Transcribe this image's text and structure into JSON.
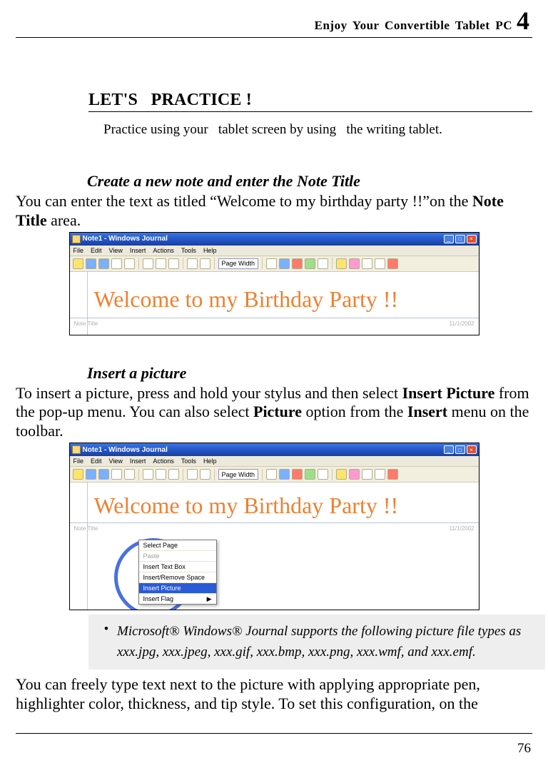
{
  "header": {
    "running_title": "Enjoy  Your  Convertible  Tablet  PC",
    "chapter_number": "4"
  },
  "section_heading_1": "L",
  "section_heading_rest": "ET'S   P",
  "section_heading_rest2": "RACTICE !",
  "intro_line": "Practice using your   tablet screen by using   the writing tablet.",
  "subhead1": "Create a new note and enter the Note Title",
  "para1_a": "You can enter the text as titled “Welcome to my birthday party !!”on the ",
  "para1_b": "Note Title",
  "para1_c": " area.",
  "subhead2": "Insert a picture",
  "para2_a": "To insert a picture, press and hold your stylus and then select ",
  "para2_b": "Insert Picture",
  "para2_c": " from the pop-up menu. You can also select ",
  "para2_d": "Picture",
  "para2_e": " option from the ",
  "para2_f": "Insert",
  "para2_g": " menu on the toolbar.",
  "note_bullet": "•",
  "note_text": "Microsoft® Windows® Journal supports the following picture file types as xxx.jpg, xxx.jpeg, xxx.gif, xxx.bmp, xxx.png, xxx.wmf, and xxx.emf.",
  "closing": "You can freely type text next to the picture with applying appropriate pen, highlighter color, thickness, and tip style. To set this configuration, on the",
  "page_number": "76",
  "journal": {
    "title": "Note1 - Windows Journal",
    "menus": [
      "File",
      "Edit",
      "View",
      "Insert",
      "Actions",
      "Tools",
      "Help"
    ],
    "page_width": "Page Width",
    "note_label": "Note Title",
    "date": "11/1/2002",
    "handwriting": "Welcome to my Birthday Party !!",
    "win_min": "_",
    "win_max": "□",
    "win_close": "×",
    "context_menu": {
      "select_page": "Select Page",
      "paste": "Paste",
      "insert_textbox": "Insert Text Box",
      "insert_remove_space": "Insert/Remove Space",
      "insert_picture": "Insert Picture",
      "insert_flag": "Insert Flag",
      "arrow": "▶"
    }
  }
}
